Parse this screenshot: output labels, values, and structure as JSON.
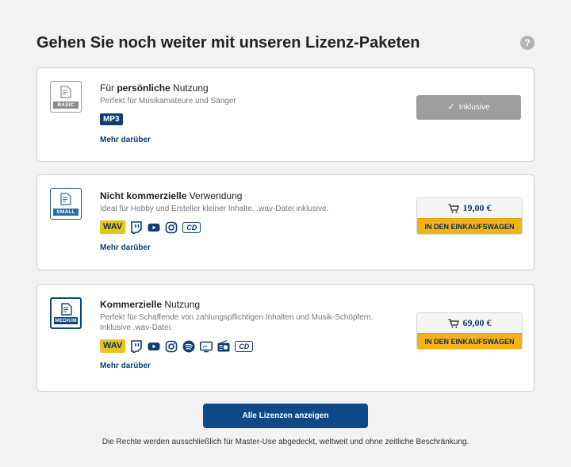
{
  "header": {
    "title": "Gehen Sie noch weiter mit unseren Lizenz-Paketen",
    "help_label": "?"
  },
  "licenses": [
    {
      "icon_tag": "BASIC",
      "title_prefix": "Für ",
      "title_bold": "persönliche",
      "title_suffix": " Nutzung",
      "description": "Perfekt für Musikamateure und Sänger",
      "format_badge": "MP3",
      "more_link": "Mehr darüber",
      "status_label": "Inklusive"
    },
    {
      "icon_tag": "SMALL",
      "title_prefix": "",
      "title_bold": "Nicht kommerzielle",
      "title_suffix": " Verwendung",
      "description": "Ideal für Hobby und Ersteller kleiner Inhalte. .wav-Datei inklusive.",
      "format_badge": "WAV",
      "format_icons": [
        "twitch-icon",
        "youtube-icon",
        "instagram-icon",
        "cd-icon"
      ],
      "cd_label": "CD",
      "more_link": "Mehr darüber",
      "price": "19,00 €",
      "cart_label": "IN DEN EINKAUFSWAGEN"
    },
    {
      "icon_tag": "MEDIUM",
      "title_prefix": "",
      "title_bold": "Kommerzielle",
      "title_suffix": " Nutzung",
      "description_line1": "Perfekt für Schaffende von zahlungspflichtigen Inhalten und Musik-Schöpfern.",
      "description_line2": "Inklusive .wav-Datei.",
      "format_badge": "WAV",
      "format_icons": [
        "twitch-icon",
        "youtube-icon",
        "instagram-icon",
        "spotify-icon",
        "tv-icon",
        "radio-icon",
        "cd-icon"
      ],
      "cd_label": "CD",
      "more_link": "Mehr darüber",
      "price": "69,00 €",
      "cart_label": "IN DEN EINKAUFSWAGEN"
    }
  ],
  "all_licenses_button": "Alle Lizenzen anzeigen",
  "footer_note": "Die Rechte werden ausschließlich für Master-Use abgedeckt, weltweit und ohne zeitliche Beschränkung.",
  "colors": {
    "primary": "#0d4a88",
    "wav_badge": "#e5c41d",
    "cart_button": "#f2b318",
    "inclusive_button": "#9d9d9d"
  }
}
